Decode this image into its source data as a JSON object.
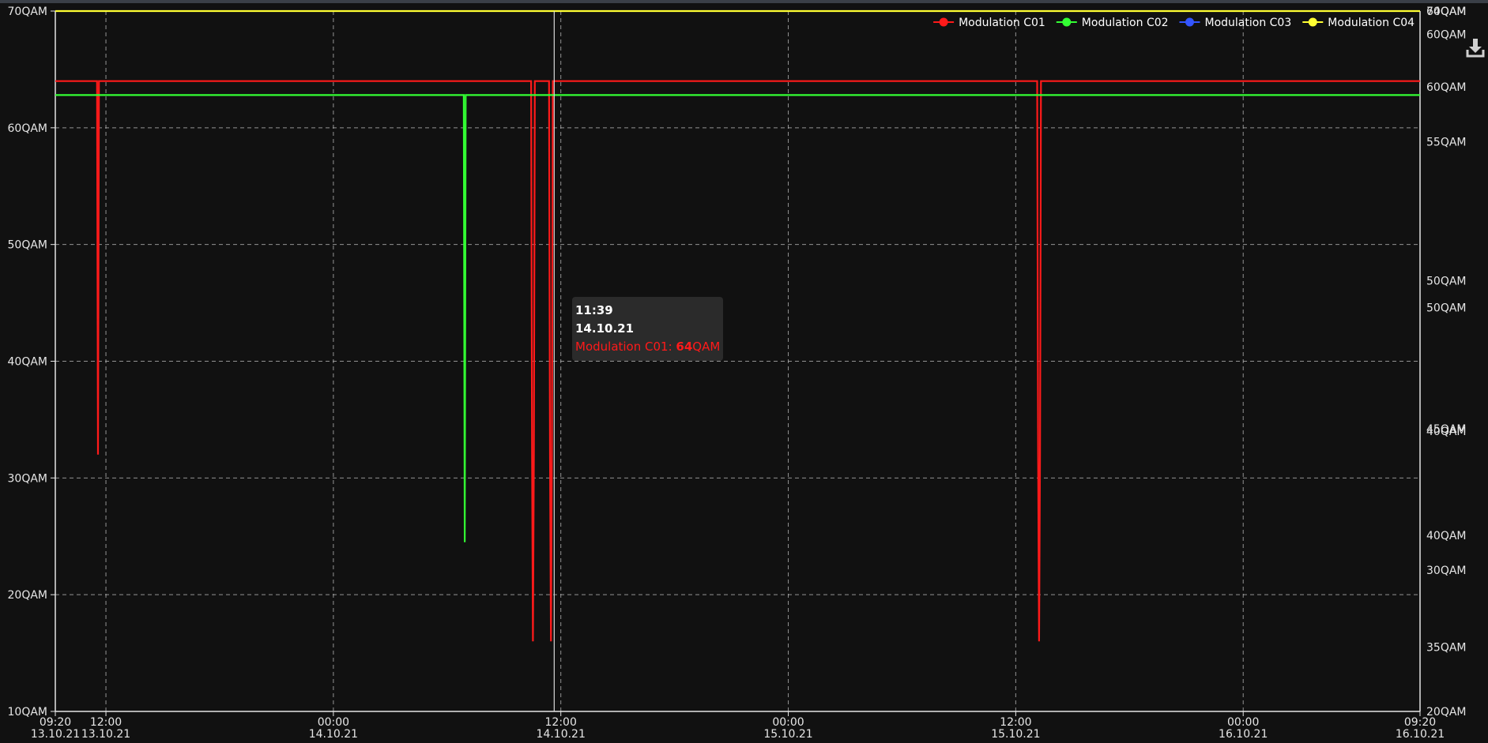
{
  "chart_data": {
    "type": "line",
    "x_label_rows": [
      [
        "09:20",
        "13.10.21"
      ],
      [
        "12:00",
        "13.10.21"
      ],
      [
        "00:00",
        "14.10.21"
      ],
      [
        "12:00",
        "14.10.21"
      ],
      [
        "00:00",
        "15.10.21"
      ],
      [
        "12:00",
        "15.10.21"
      ],
      [
        "00:00",
        "16.10.21"
      ],
      [
        "09:20",
        "16.10.21"
      ]
    ],
    "x_ticks_hours": [
      0,
      2.67,
      14.67,
      26.67,
      38.67,
      50.67,
      62.67,
      72
    ],
    "xlim_hours": [
      0,
      72
    ],
    "y_left": {
      "ticks": [
        "10QAM",
        "20QAM",
        "30QAM",
        "40QAM",
        "50QAM",
        "60QAM",
        "70QAM"
      ],
      "tick_values": [
        10,
        20,
        30,
        40,
        50,
        60,
        70
      ],
      "ylim": [
        10,
        70
      ]
    },
    "y_right": {
      "labels": [
        {
          "text": "20QAM",
          "value": 10
        },
        {
          "text": "35QAM",
          "value": 15.5
        },
        {
          "text": "30QAM",
          "value": 22.1
        },
        {
          "text": "40QAM",
          "value": 25.1
        },
        {
          "text": "45QAM",
          "value": 34.2
        },
        {
          "text": "40QAM",
          "value": 34.0
        },
        {
          "text": "50QAM",
          "value": 44.6
        },
        {
          "text": "50QAM",
          "value": 46.9
        },
        {
          "text": "55QAM",
          "value": 58.8
        },
        {
          "text": "60QAM",
          "value": 63.5
        },
        {
          "text": "60QAM",
          "value": 68.0
        },
        {
          "text": "64QAM",
          "value": 70.0
        },
        {
          "text": "70QAM",
          "value": 70.0
        }
      ]
    },
    "grid": true,
    "legend_position": "top-right",
    "series": [
      {
        "name": "Modulation C01",
        "color": "#ff1a1a",
        "points": [
          [
            0,
            64
          ],
          [
            2.2,
            64
          ],
          [
            2.25,
            32
          ],
          [
            2.3,
            64
          ],
          [
            25.1,
            64
          ],
          [
            25.15,
            32
          ],
          [
            25.2,
            16
          ],
          [
            25.25,
            32
          ],
          [
            25.3,
            64
          ],
          [
            26.05,
            64
          ],
          [
            26.1,
            32
          ],
          [
            26.15,
            16
          ],
          [
            26.2,
            32
          ],
          [
            26.25,
            64
          ],
          [
            51.8,
            64
          ],
          [
            51.85,
            32
          ],
          [
            51.9,
            16
          ],
          [
            51.95,
            32
          ],
          [
            52.0,
            64
          ],
          [
            72,
            64
          ]
        ]
      },
      {
        "name": "Modulation C02",
        "color": "#33ff33",
        "points": [
          [
            0,
            62.8
          ],
          [
            21.55,
            62.8
          ],
          [
            21.6,
            24.5
          ],
          [
            21.65,
            62.8
          ],
          [
            72,
            62.8
          ]
        ]
      },
      {
        "name": "Modulation C03",
        "color": "#3355ff",
        "points": []
      },
      {
        "name": "Modulation C04",
        "color": "#ffff33",
        "points": [
          [
            0,
            70
          ],
          [
            72,
            70
          ]
        ]
      }
    ],
    "cursor_hours": 26.32
  },
  "tooltip": {
    "time": "11:39",
    "date": "14.10.21",
    "series": "Modulation C01: ",
    "value": "64",
    "unit": "QAM"
  },
  "toolbar": {
    "download_icon": "download-icon"
  },
  "colors": {
    "background": "#111111",
    "grid": "#bfbfbf",
    "axis": "#e6e6e6"
  }
}
